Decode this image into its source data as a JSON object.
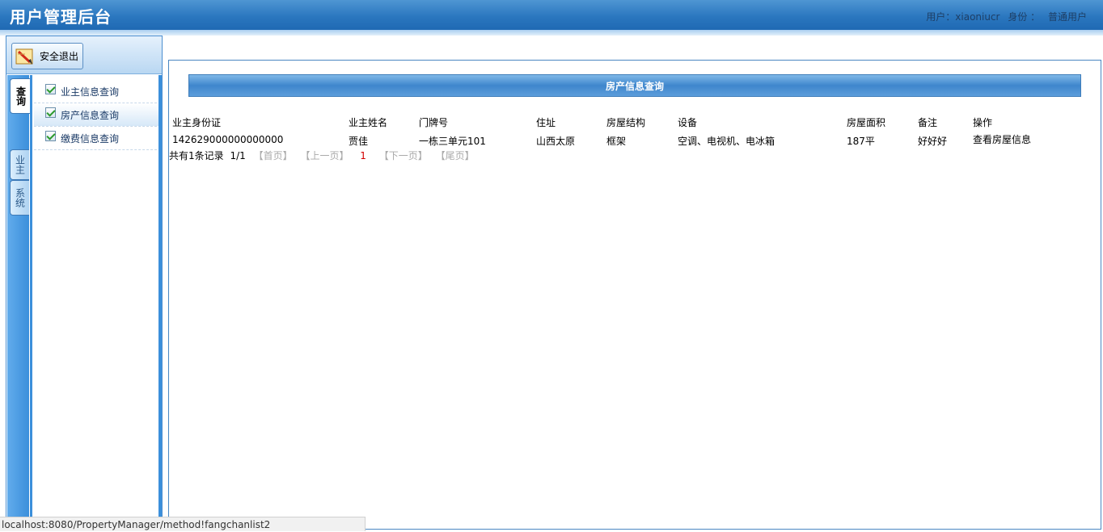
{
  "header": {
    "title": "用户管理后台",
    "user_label": "用户：",
    "username": "xiaoniucr",
    "role_label": "身份 ：",
    "role": "普通用户"
  },
  "sidebar": {
    "logout_label": "安全退出",
    "tabs": [
      {
        "label": "查询",
        "active": true
      },
      {
        "label": "业主",
        "active": false
      },
      {
        "label": "系统",
        "active": false
      }
    ],
    "menu": [
      {
        "label": "业主信息查询",
        "selected": false
      },
      {
        "label": "房产信息查询",
        "selected": true
      },
      {
        "label": "缴费信息查询",
        "selected": false
      }
    ]
  },
  "main": {
    "section_title": "房产信息查询",
    "table": {
      "headers": [
        "业主身份证",
        "业主姓名",
        "门牌号",
        "住址",
        "房屋结构",
        "设备",
        "房屋面积",
        "备注",
        "操作"
      ],
      "rows": [
        [
          "142629000000000000",
          "贾佳",
          "一栋三单元101",
          "山西太原",
          "框架",
          "空调、电视机、电冰箱",
          "187平",
          "好好好",
          "查看房屋信息"
        ]
      ]
    },
    "pager": {
      "summary": "共有1条记录",
      "page": "1/1",
      "first": "【首页】",
      "prev": "【上一页】",
      "current": "1",
      "next": "【下一页】",
      "last": "【尾页】"
    }
  },
  "status_bar": {
    "url": "localhost:8080/PropertyManager/method!fangchanlist2"
  }
}
